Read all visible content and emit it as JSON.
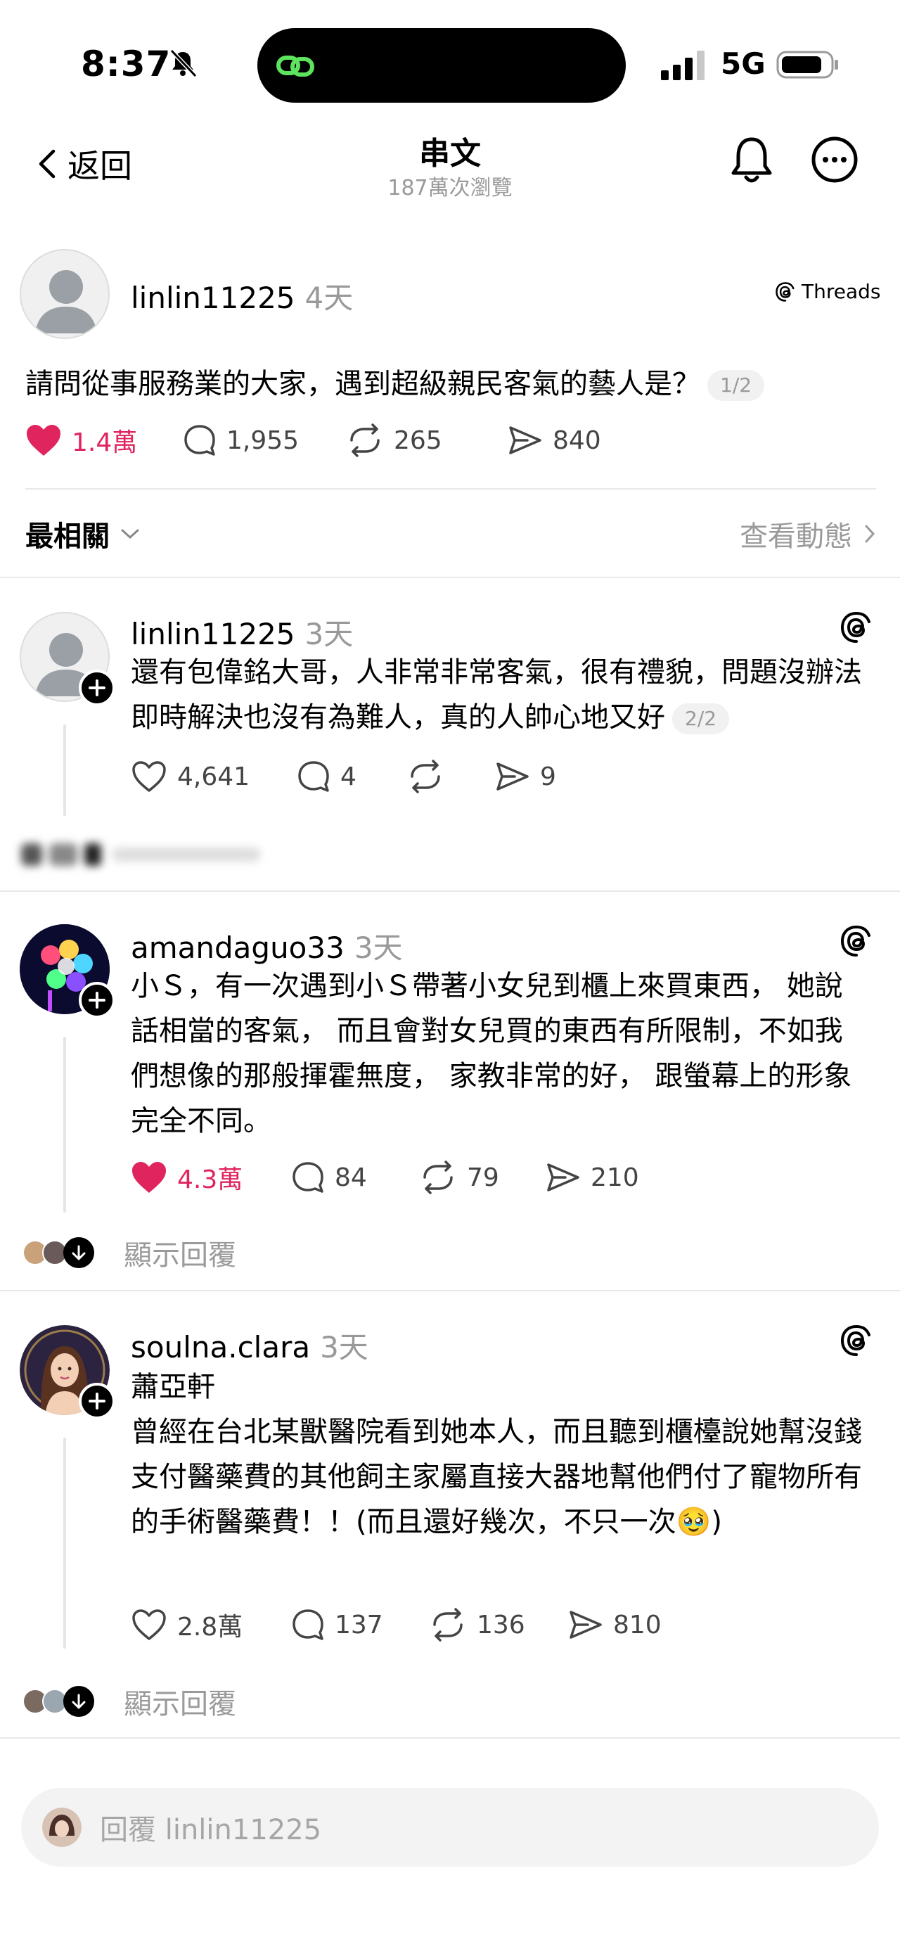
{
  "status_bar": {
    "time": "8:37",
    "network": "5G"
  },
  "header": {
    "back_label": "返回",
    "title": "串文",
    "views": "187萬次瀏覽"
  },
  "main_post": {
    "username": "linlin11225",
    "when": "4天",
    "source_label": "Threads",
    "text": "請問從事服務業的大家，遇到超級親民客氣的藝人是？",
    "page_badge": "1/2",
    "likes": "1.4萬",
    "comments": "1,955",
    "reposts": "265",
    "shares": "840"
  },
  "sort": {
    "label": "最相關",
    "view_activity": "查看動態"
  },
  "replies": [
    {
      "username": "linlin11225",
      "when": "3天",
      "text": "還有包偉銘大哥，人非常非常客氣，很有禮貌，問題沒辦法即時解決也沒有為難人，真的人帥心地又好",
      "page_badge": "2/2",
      "likes": "4,641",
      "comments": "4",
      "reposts": "",
      "shares": "9"
    },
    {
      "username": "amandaguo33",
      "when": "3天",
      "text": "小Ｓ，有一次遇到小Ｓ帶著小女兒到櫃上來買東西， 她說話相當的客氣， 而且會對女兒買的東西有所限制，不如我們想像的那般揮霍無度， 家教非常的好， 跟螢幕上的形象完全不同。",
      "likes": "4.3萬",
      "comments": "84",
      "reposts": "79",
      "shares": "210",
      "show_replies": "顯示回覆"
    },
    {
      "username": "soulna.clara",
      "when": "3天",
      "title": "蕭亞軒",
      "text": "曾經在台北某獸醫院看到她本人，而且聽到櫃檯說她幫沒錢支付醫藥費的其他飼主家屬直接大器地幫他們付了寵物所有的手術醫藥費！！(而且還好幾次，不只一次",
      "text_tail": ")",
      "emoji": "🥹",
      "likes": "2.8萬",
      "comments": "137",
      "reposts": "136",
      "shares": "810",
      "show_replies": "顯示回覆"
    }
  ],
  "reply_bar": {
    "placeholder": "回覆 linlin11225"
  },
  "colors": {
    "like_red": "#e0245e",
    "muted": "#9a9a9a"
  }
}
